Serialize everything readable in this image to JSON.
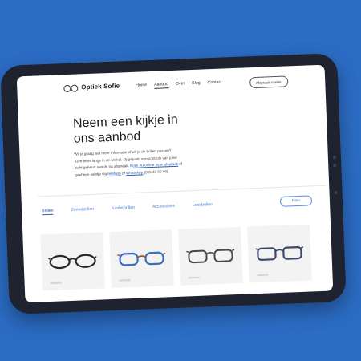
{
  "brand": {
    "name": "Optiek Sofie",
    "icon": "glasses-logo-icon"
  },
  "nav": {
    "items": [
      "Home",
      "Aanbod",
      "Over",
      "Blog",
      "Contact"
    ],
    "active": "Aanbod",
    "cta": "Afspraak maken"
  },
  "hero": {
    "title_line1": "Neem een kijkje in",
    "title_line2": "ons aanbod",
    "text_1": "Wil je graag wat meer informatie of wil je de brillen passen?",
    "text_2": "Kom eens langs in de winkel. Opgepast: een controle van jouw",
    "text_3a": "zicht gebeurt steeds na afspraak. ",
    "link_booking": "Boek nu online jouw afspraak",
    "text_3b": " of",
    "text_4a": "geef een seintje via ",
    "link_phone": "telefoon",
    "text_4b": " of ",
    "link_whatsapp": "WhatsApp",
    "text_4c": " (055 40 50 68)."
  },
  "categories": {
    "tabs": [
      "Brillen",
      "Zonnebrillen",
      "Kinderbrillen",
      "Accessoires",
      "Leesbrillen"
    ],
    "active": "Brillen",
    "filter": "Filter"
  },
  "products": [
    {
      "frame_color": "#2a2524",
      "icon": "glasses-icon"
    },
    {
      "frame_color": "#3a6fc2",
      "icon": "glasses-icon"
    },
    {
      "frame_color": "#4a4a4a",
      "icon": "glasses-icon"
    },
    {
      "frame_color": "#3c4a6a",
      "icon": "glasses-icon"
    }
  ],
  "colors": {
    "background": "#2b6cc4",
    "accent": "#2a5db0",
    "device": "#1f2330"
  }
}
